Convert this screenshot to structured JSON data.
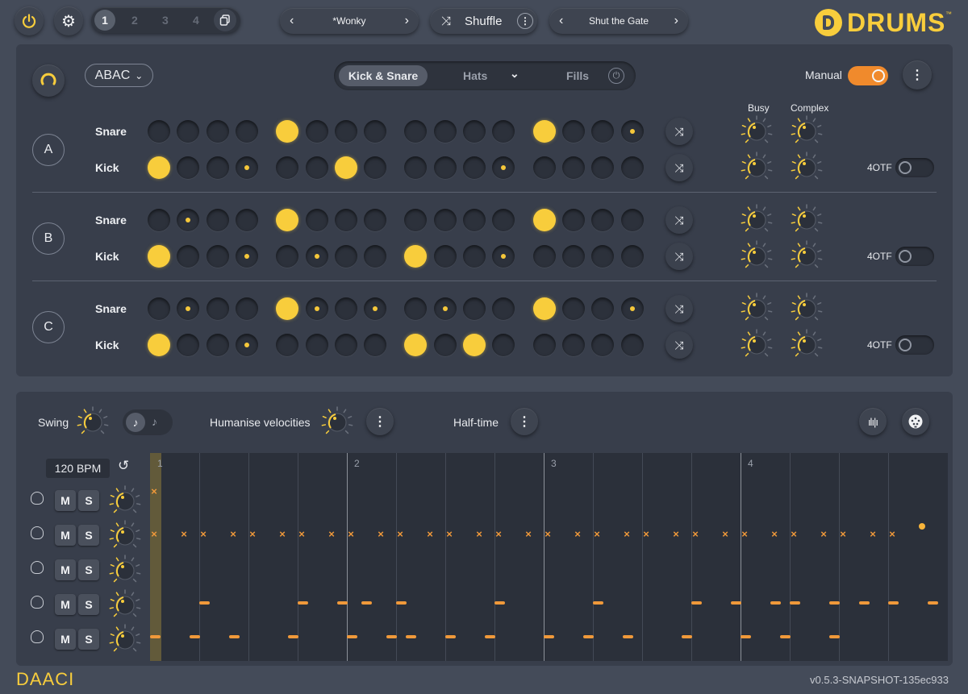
{
  "header": {
    "power_icon": "power-icon",
    "settings_icon": "gear-icon",
    "slots": [
      "1",
      "2",
      "3",
      "4"
    ],
    "active_slot": "1",
    "copy_icon": "copy-icon",
    "preset_name": "*Wonky",
    "shuffle_label": "Shuffle",
    "preset2_name": "Shut the Gate",
    "logo_text": "DRUMS"
  },
  "pattern": {
    "arrangement": "ABAC",
    "tabs": [
      "Kick & Snare",
      "Hats",
      "Fills"
    ],
    "active_tab": "Kick & Snare",
    "manual_label": "Manual",
    "manual_on": true,
    "busy_label": "Busy",
    "complex_label": "Complex",
    "otf_label": "4OTF",
    "sections": [
      {
        "name": "A",
        "rows": [
          {
            "label": "Snare",
            "steps": [
              0,
              0,
              0,
              0,
              2,
              0,
              0,
              0,
              0,
              0,
              0,
              0,
              2,
              0,
              0,
              1
            ]
          },
          {
            "label": "Kick",
            "steps": [
              2,
              0,
              0,
              1,
              0,
              0,
              2,
              0,
              0,
              0,
              0,
              1,
              0,
              0,
              0,
              0
            ]
          }
        ]
      },
      {
        "name": "B",
        "rows": [
          {
            "label": "Snare",
            "steps": [
              0,
              1,
              0,
              0,
              2,
              0,
              0,
              0,
              0,
              0,
              0,
              0,
              2,
              0,
              0,
              0
            ]
          },
          {
            "label": "Kick",
            "steps": [
              2,
              0,
              0,
              1,
              0,
              1,
              0,
              0,
              2,
              0,
              0,
              1,
              0,
              0,
              0,
              0
            ]
          }
        ]
      },
      {
        "name": "C",
        "rows": [
          {
            "label": "Snare",
            "steps": [
              0,
              1,
              0,
              0,
              2,
              1,
              0,
              1,
              0,
              1,
              0,
              0,
              2,
              0,
              0,
              1
            ]
          },
          {
            "label": "Kick",
            "steps": [
              2,
              0,
              0,
              1,
              0,
              0,
              0,
              0,
              2,
              0,
              2,
              0,
              0,
              0,
              0,
              0
            ]
          }
        ]
      }
    ]
  },
  "controls": {
    "swing_label": "Swing",
    "humanise_label": "Humanise velocities",
    "halftime_label": "Half-time",
    "bpm": "120 BPM",
    "bar_numbers": [
      "1",
      "2",
      "3",
      "4"
    ],
    "tracks": [
      {
        "icon": "cymbal-icon",
        "mute": "M",
        "solo": "S"
      },
      {
        "icon": "hihat-icon",
        "mute": "M",
        "solo": "S"
      },
      {
        "icon": "tom-icon",
        "mute": "M",
        "solo": "S"
      },
      {
        "icon": "snare-icon",
        "mute": "M",
        "solo": "S"
      },
      {
        "icon": "kick-icon",
        "mute": "M",
        "solo": "S"
      }
    ]
  },
  "footer": {
    "brand": "DAACI",
    "version": "v0.5.3-SNAPSHOT-135ec933"
  },
  "colors": {
    "accent_yellow": "#f8cd3c",
    "accent_orange": "#f0993a",
    "toggle_orange": "#f08a2c",
    "panel": "#383e4b",
    "background": "#444b59"
  }
}
